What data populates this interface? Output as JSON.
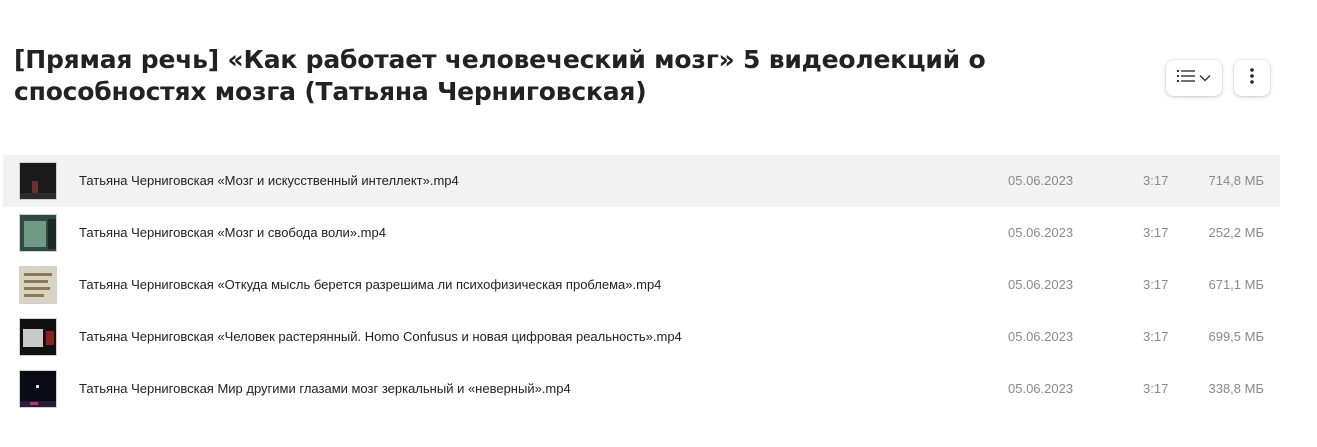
{
  "folder": {
    "title": "[Прямая речь] «Как работает человеческий мозг» 5 видеолекций о способностях мозга (Татьяна Черниговская)"
  },
  "toolbar": {
    "view_icon": "list-view-icon",
    "dropdown_icon": "chevron-down-icon",
    "more_icon": "more-vertical-icon"
  },
  "files": [
    {
      "name": "Татьяна Черниговская «Мозг и искусственный интеллект».mp4",
      "date": "05.06.2023",
      "duration": "3:17",
      "size": "714,8 МБ"
    },
    {
      "name": "Татьяна Черниговская «Мозг и свобода воли».mp4",
      "date": "05.06.2023",
      "duration": "3:17",
      "size": "252,2 МБ"
    },
    {
      "name": "Татьяна Черниговская «Откуда мысль берется разрешима ли психофизическая проблема».mp4",
      "date": "05.06.2023",
      "duration": "3:17",
      "size": "671,1 МБ"
    },
    {
      "name": "Татьяна Черниговская «Человек растерянный. Homo Confusus и новая цифровая реальность».mp4",
      "date": "05.06.2023",
      "duration": "3:17",
      "size": "699,5 МБ"
    },
    {
      "name": "Татьяна Черниговская Мир другими глазами мозг зеркальный и «неверный».mp4",
      "date": "05.06.2023",
      "duration": "3:17",
      "size": "338,8 МБ"
    }
  ]
}
